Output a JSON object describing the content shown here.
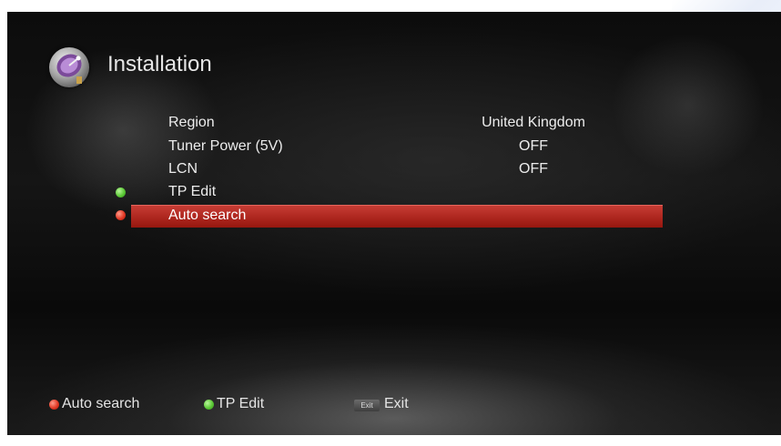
{
  "header": {
    "title": "Installation",
    "icon": "satellite-dish-icon"
  },
  "menu": {
    "items": [
      {
        "label": "Region",
        "value": "United Kingdom"
      },
      {
        "label": "Tuner Power (5V)",
        "value": "OFF"
      },
      {
        "label": "LCN",
        "value": "OFF"
      },
      {
        "label": "TP Edit",
        "value": ""
      },
      {
        "label": "Auto search",
        "value": "",
        "selected": true
      }
    ],
    "highlight_color": "#b52b23"
  },
  "footer": {
    "red": {
      "label": "Auto search",
      "color": "#e33a26"
    },
    "green": {
      "label": "TP Edit",
      "color": "#5cc936"
    },
    "exit": {
      "key": "Exit",
      "label": "Exit"
    }
  }
}
